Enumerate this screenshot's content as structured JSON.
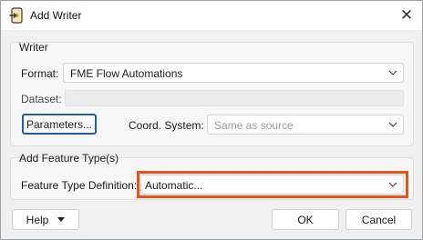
{
  "window": {
    "title": "Add Writer",
    "app_icon": "fme-writer-icon",
    "close_label": "✕"
  },
  "writer_group": {
    "label": "Writer",
    "format": {
      "label": "Format:",
      "value": "FME Flow Automations"
    },
    "dataset": {
      "label": "Dataset:",
      "value": ""
    },
    "parameters_button": "Parameters...",
    "coord_system": {
      "label": "Coord. System:",
      "value": "Same as source"
    }
  },
  "feature_group": {
    "label": "Add Feature Type(s)",
    "definition": {
      "label": "Feature Type Definition:",
      "value": "Automatic..."
    }
  },
  "footer": {
    "help_label": "Help",
    "ok_label": "OK",
    "cancel_label": "Cancel"
  },
  "colors": {
    "highlight": "#e8531a",
    "focus": "#1f5fa8"
  }
}
